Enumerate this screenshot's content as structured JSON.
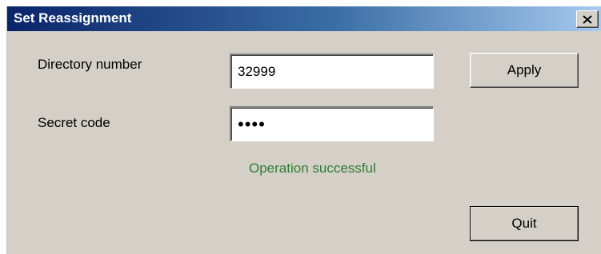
{
  "window": {
    "title": "Set Reassignment",
    "close_icon": "close-icon"
  },
  "form": {
    "directory_number": {
      "label": "Directory number",
      "value": "32999"
    },
    "secret_code": {
      "label": "Secret code",
      "value": "1234"
    }
  },
  "buttons": {
    "apply_label": "Apply",
    "quit_label": "Quit"
  },
  "status": {
    "message": "Operation successful",
    "color": "#2e7d32"
  }
}
